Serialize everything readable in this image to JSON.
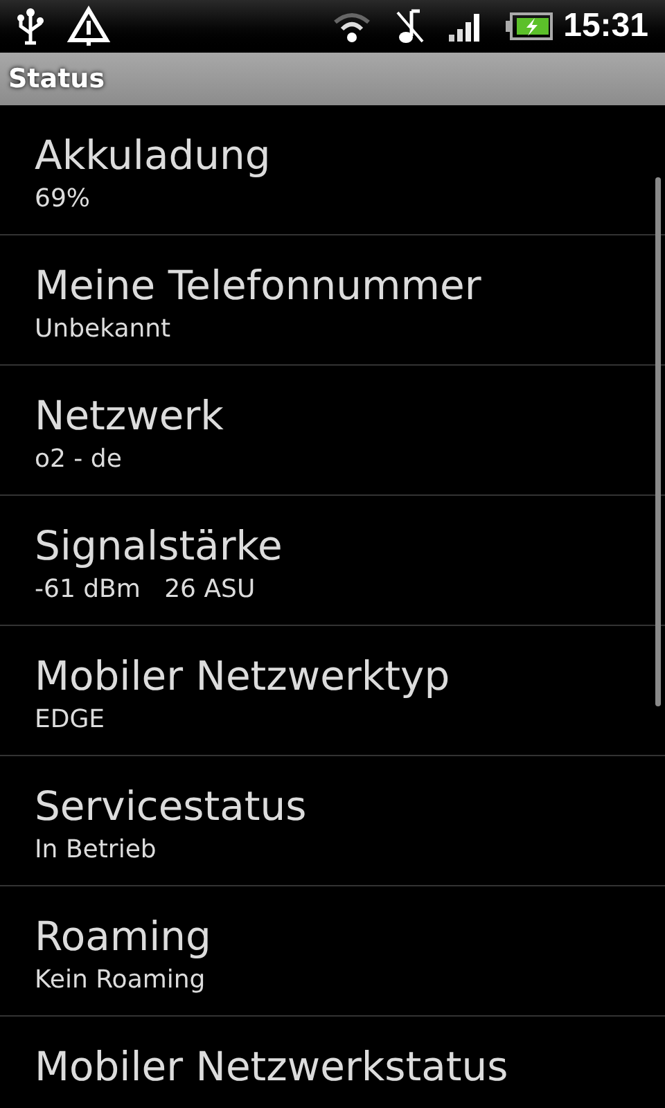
{
  "status_bar": {
    "time": "15:31"
  },
  "title_bar": {
    "title": "Status"
  },
  "items": [
    {
      "title": "Akkuladung",
      "value": "69%"
    },
    {
      "title": "Meine Telefonnummer",
      "value": "Unbekannt"
    },
    {
      "title": "Netzwerk",
      "value": "o2 - de"
    },
    {
      "title": "Signalstärke",
      "value": "-61 dBm   26 ASU"
    },
    {
      "title": "Mobiler Netzwerktyp",
      "value": "EDGE"
    },
    {
      "title": "Servicestatus",
      "value": "In Betrieb"
    },
    {
      "title": "Roaming",
      "value": "Kein Roaming"
    },
    {
      "title": "Mobiler Netzwerkstatus"
    }
  ]
}
